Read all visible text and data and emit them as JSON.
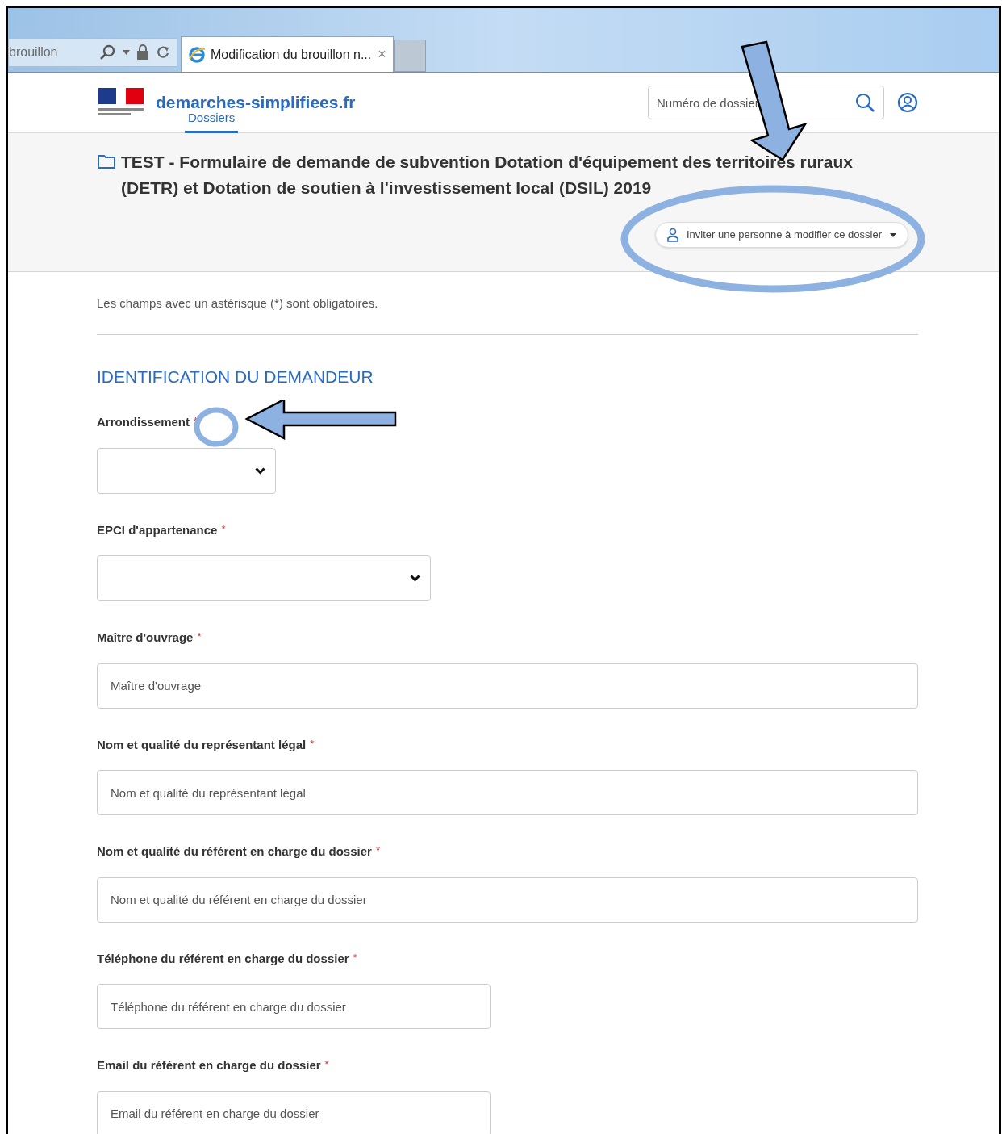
{
  "browser": {
    "address_fragment": "brouillon",
    "tabs": [
      {
        "title": "Modification du brouillon n...",
        "close": "×",
        "selected": true
      }
    ]
  },
  "header": {
    "logo_text": "demarches-simplifiees.fr",
    "nav_tabs": [
      {
        "label": "Dossiers",
        "selected": true
      }
    ],
    "search": {
      "placeholder": "Numéro de dossier"
    }
  },
  "dossier": {
    "title": "TEST - Formulaire de demande de subvention Dotation d'équipement des territoires ruraux (DETR) et Dotation de soutien à l'investissement local (DSIL) 2019",
    "invite_button": "Inviter une personne à modifier ce dossier"
  },
  "form": {
    "notice": "Les champs avec un astérisque (*) sont obligatoires.",
    "section_title": "IDENTIFICATION DU DEMANDEUR",
    "fields": [
      {
        "label": "Arrondissement",
        "required_mark": "*",
        "kind": "select"
      },
      {
        "label": "EPCI d'appartenance",
        "required_mark": "*",
        "kind": "select"
      },
      {
        "label": "Maître d'ouvrage",
        "required_mark": "*",
        "kind": "text",
        "placeholder": "Maître d'ouvrage"
      },
      {
        "label": "Nom et qualité du représentant légal",
        "required_mark": "*",
        "kind": "text",
        "placeholder": "Nom et qualité du représentant légal"
      },
      {
        "label": "Nom et qualité du référent en charge du dossier",
        "required_mark": "*",
        "kind": "text",
        "placeholder": "Nom et qualité du référent en charge du dossier"
      },
      {
        "label": "Téléphone du référent en charge du dossier",
        "required_mark": "*",
        "kind": "tel",
        "placeholder": "Téléphone du référent en charge du dossier"
      },
      {
        "label": "Email du référent en charge du dossier",
        "required_mark": "*",
        "kind": "email",
        "placeholder": "Email du référent en charge du dossier"
      }
    ]
  }
}
